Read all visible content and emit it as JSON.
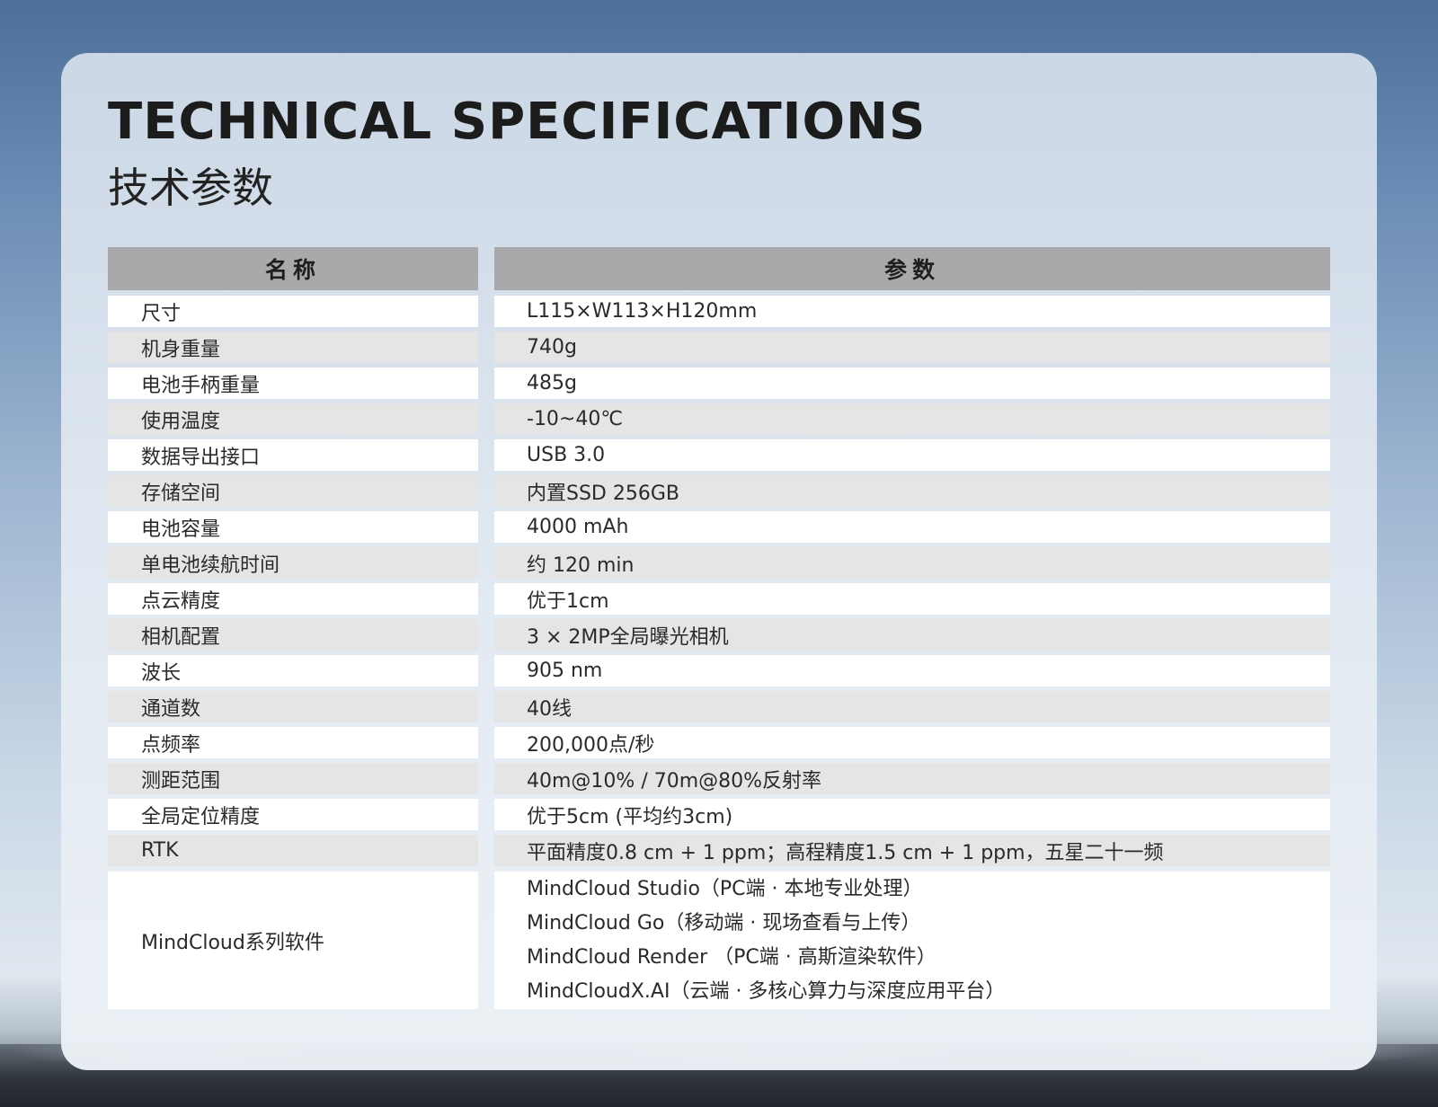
{
  "title_en": "TECHNICAL  SPECIFICATIONS",
  "title_cn": "技术参数",
  "table": {
    "header": {
      "name": "名称",
      "value": "参数"
    },
    "rows": [
      {
        "name": "尺寸",
        "value": "L115×W113×H120mm"
      },
      {
        "name": "机身重量",
        "value": "740g"
      },
      {
        "name": "电池手柄重量",
        "value": "485g"
      },
      {
        "name": "使用温度",
        "value": "-10~40℃"
      },
      {
        "name": "数据导出接口",
        "value": "USB 3.0"
      },
      {
        "name": "存储空间",
        "value": "内置SSD 256GB"
      },
      {
        "name": "电池容量",
        "value": "4000 mAh"
      },
      {
        "name": "单电池续航时间",
        "value": "约 120 min"
      },
      {
        "name": "点云精度",
        "value": "优于1cm"
      },
      {
        "name": "相机配置",
        "value": "3 × 2MP全局曝光相机"
      },
      {
        "name": "波长",
        "value": "905 nm"
      },
      {
        "name": "通道数",
        "value": "40线"
      },
      {
        "name": "点频率",
        "value": "200,000点/秒"
      },
      {
        "name": "测距范围",
        "value": "40m@10% / 70m@80%反射率"
      },
      {
        "name": "全局定位精度",
        "value": "优于5cm (平均约3cm)"
      },
      {
        "name": "RTK",
        "value": "平面精度0.8 cm + 1 ppm；高程精度1.5 cm + 1 ppm，五星二十一频"
      }
    ],
    "software": {
      "name": "MindCloud系列软件",
      "values": [
        "MindCloud Studio（PC端 · 本地专业处理）",
        "MindCloud Go（移动端 · 现场查看与上传）",
        "MindCloud Render （PC端 · 高斯渲染软件）",
        "MindCloudX.AI（云端 · 多核心算力与深度应用平台）"
      ]
    }
  }
}
